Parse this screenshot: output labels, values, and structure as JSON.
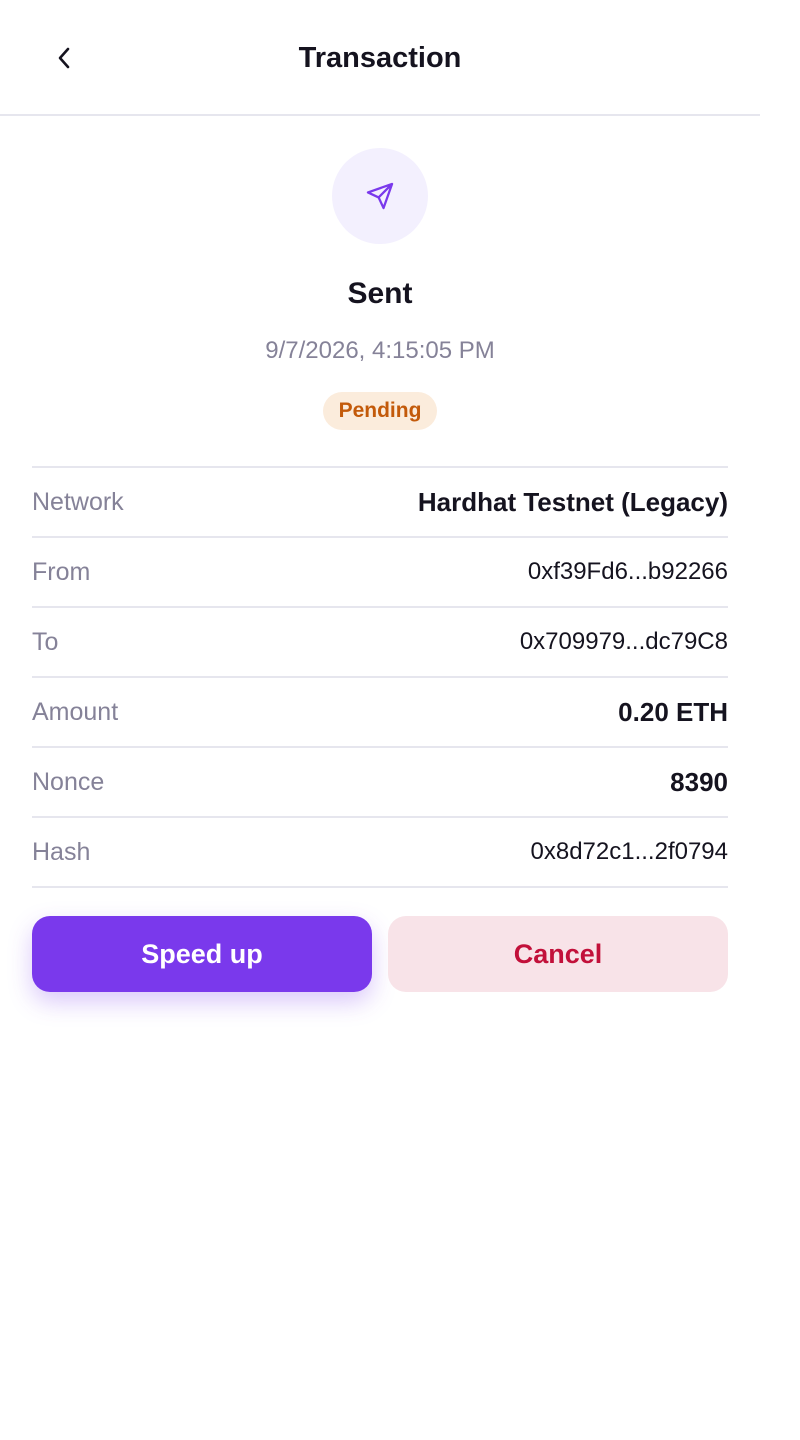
{
  "header": {
    "title": "Transaction",
    "back_icon": "chevron-left-icon"
  },
  "hero": {
    "icon": "send-arrow-icon",
    "status_title": "Sent",
    "timestamp": "9/7/2026, 4:15:05 PM",
    "badge": "Pending"
  },
  "details": {
    "network": {
      "label": "Network",
      "value": "Hardhat Testnet (Legacy)"
    },
    "from": {
      "label": "From",
      "value": "0xf39Fd6...b92266"
    },
    "to": {
      "label": "To",
      "value": "0x709979...dc79C8"
    },
    "amount": {
      "label": "Amount",
      "value": "0.20 ETH"
    },
    "nonce": {
      "label": "Nonce",
      "value": "8390"
    },
    "hash": {
      "label": "Hash",
      "value": "0x8d72c1...2f0794"
    }
  },
  "actions": {
    "speed_up": "Speed up",
    "cancel": "Cancel"
  },
  "colors": {
    "accent": "#7a39ec",
    "pending_bg": "#fbecdc",
    "pending_text": "#c35a0a",
    "danger_bg": "#f8e3e8",
    "danger_text": "#c2103a"
  }
}
